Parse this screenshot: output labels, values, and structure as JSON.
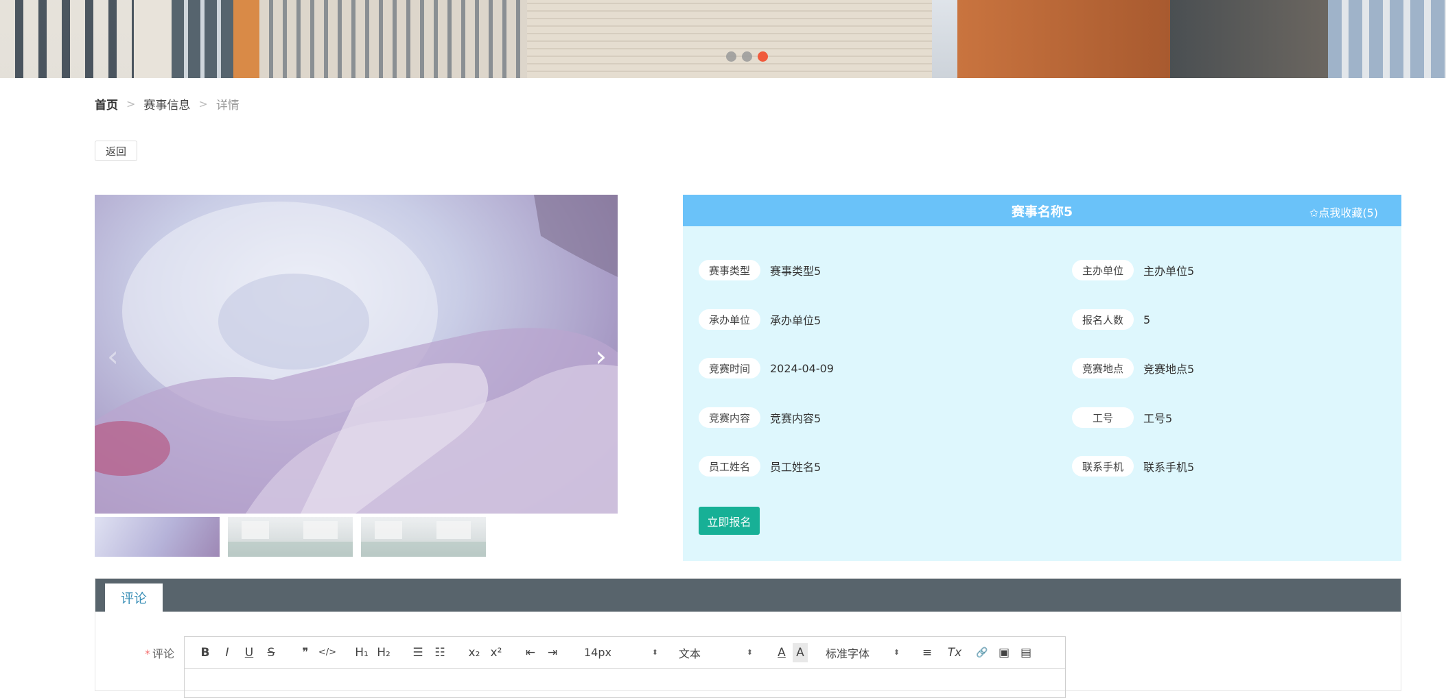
{
  "banner": {
    "active_dot": 2,
    "dots": 3
  },
  "breadcrumb": {
    "home": "首页",
    "section": "赛事信息",
    "current": "详情",
    "separator": ">"
  },
  "back_button": "返回",
  "gallery": {
    "arrow_prev": "‹",
    "arrow_next": "›",
    "thumbnails": 3
  },
  "detail": {
    "title": "赛事名称5",
    "favorite": "✩点我收藏(5)",
    "fields": [
      {
        "label": "赛事类型",
        "value": "赛事类型5"
      },
      {
        "label": "主办单位",
        "value": "主办单位5"
      },
      {
        "label": "承办单位",
        "value": "承办单位5"
      },
      {
        "label": "报名人数",
        "value": "5"
      },
      {
        "label": "竞赛时间",
        "value": "2024-04-09"
      },
      {
        "label": "竞赛地点",
        "value": "竞赛地点5"
      },
      {
        "label": "竞赛内容",
        "value": "竞赛内容5"
      },
      {
        "label": "工号",
        "value": "工号5"
      },
      {
        "label": "员工姓名",
        "value": "员工姓名5"
      },
      {
        "label": "联系手机",
        "value": "联系手机5"
      }
    ],
    "signup_button": "立即报名"
  },
  "comments": {
    "tab": "评论",
    "field_label": "评论",
    "required_mark": "*",
    "toolbar": {
      "bold": "B",
      "italic": "I",
      "underline": "U",
      "strike": "S",
      "blockquote": "❞",
      "code": "</>",
      "h1": "H₁",
      "h2": "H₂",
      "ordered_list": "☰",
      "bullet_list": "☷",
      "subscript": "x₂",
      "superscript": "x²",
      "outdent": "⇤",
      "indent": "⇥",
      "size": "14px",
      "header": "文本",
      "font": "标准字体",
      "color": "A",
      "background": "A",
      "align": "≡",
      "clean": "Tx",
      "link": "🔗",
      "image": "▣",
      "video": "▤"
    }
  }
}
